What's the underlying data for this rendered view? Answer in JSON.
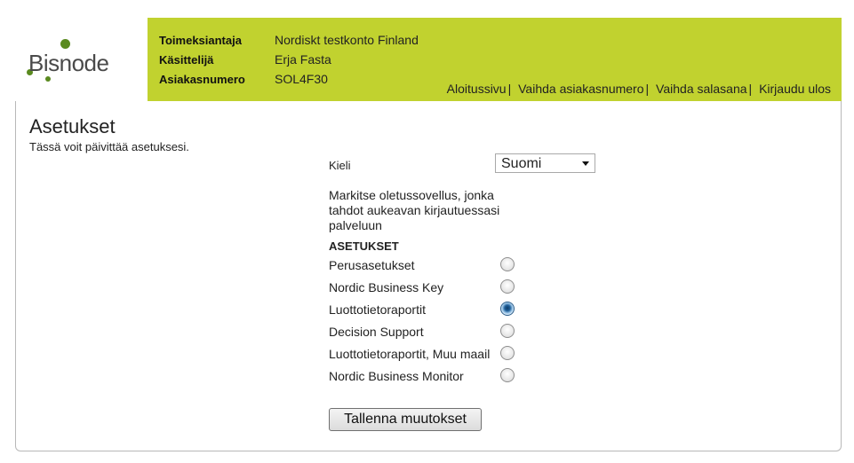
{
  "logo": {
    "text": "Bisnode"
  },
  "header": {
    "rows": [
      {
        "label": "Toimeksiantaja",
        "value": "Nordiskt testkonto Finland"
      },
      {
        "label": "Käsittelijä",
        "value": "Erja Fasta"
      },
      {
        "label": "Asiakasnumero",
        "value": "SOL4F30"
      }
    ],
    "nav": [
      {
        "label": "Aloitussivu"
      },
      {
        "label": "Vaihda asiakasnumero"
      },
      {
        "label": "Vaihda salasana"
      },
      {
        "label": "Kirjaudu ulos"
      }
    ],
    "nav_separator": "|"
  },
  "page": {
    "title": "Asetukset",
    "subtitle": "Tässä voit päivittää asetuksesi."
  },
  "form": {
    "language_label": "Kieli",
    "language_selected": "Suomi",
    "description": "Markitse oletussovellus, jonka tahdot aukeavan kirjautuessasi palveluun",
    "section_heading": "ASETUKSET",
    "options": [
      {
        "label": "Perusasetukset",
        "checked": false
      },
      {
        "label": "Nordic Business Key",
        "checked": false
      },
      {
        "label": "Luottotietoraportit",
        "checked": true
      },
      {
        "label": "Decision Support",
        "checked": false
      },
      {
        "label": "Luottotietoraportit, Muu maailma",
        "checked": false
      },
      {
        "label": "Nordic Business Monitor",
        "checked": false
      }
    ],
    "save_label": "Tallenna muutokset"
  },
  "colors": {
    "header_bg": "#c1d22f",
    "logo_dot": "#5a8a1f"
  }
}
